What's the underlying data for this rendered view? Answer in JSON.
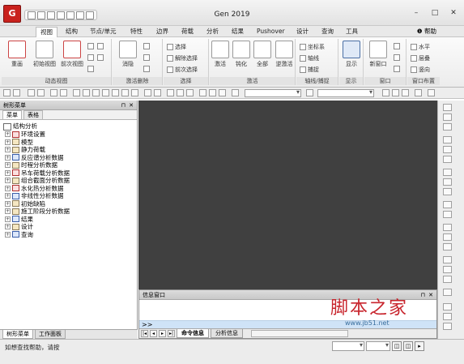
{
  "app": {
    "logo_text": "G",
    "title": "Gen 2019",
    "window_controls": [
      "–",
      "□",
      "✕"
    ]
  },
  "menu": {
    "tabs": [
      "视图",
      "结构",
      "节点/单元",
      "特性",
      "边界",
      "荷载",
      "分析",
      "结果",
      "Pushover",
      "设计",
      "查询",
      "工具"
    ],
    "active": "视图",
    "help": "帮助"
  },
  "ribbon": {
    "groups": [
      {
        "label": "动态视图",
        "big": [
          "重画",
          "初始视图",
          "前次视图"
        ]
      },
      {
        "label": "激活删除",
        "big": [
          "消隐"
        ]
      },
      {
        "label": "选择",
        "small": [
          "选择",
          "解除选择",
          "前次选择"
        ]
      },
      {
        "label": "激活",
        "big": [
          "激活",
          "钝化",
          "全部",
          "逆激活"
        ]
      },
      {
        "label": "轴线/捕捉",
        "small": [
          "坐标系",
          "轴线",
          "捕捉"
        ]
      },
      {
        "label": "显示",
        "big": [
          "显示"
        ]
      },
      {
        "label": "窗口",
        "big": [
          "新窗口"
        ]
      },
      {
        "label": "窗口布置",
        "small": [
          "水平",
          "层叠",
          "竖向"
        ]
      }
    ]
  },
  "left_panel": {
    "title": "树形菜单",
    "tabs": [
      "菜单",
      "表格"
    ],
    "active_tab": "菜单",
    "root": "结构分析",
    "items": [
      {
        "label": "环境设置",
        "tone": "red"
      },
      {
        "label": "模型",
        "tone": "normal"
      },
      {
        "label": "静力荷载",
        "tone": "normal"
      },
      {
        "label": "反应谱分析数据",
        "tone": "blue"
      },
      {
        "label": "时程分析数据",
        "tone": "normal"
      },
      {
        "label": "吊车荷载分析数据",
        "tone": "red"
      },
      {
        "label": "组合截面分析数据",
        "tone": "normal"
      },
      {
        "label": "水化热分析数据",
        "tone": "red"
      },
      {
        "label": "非线性分析数据",
        "tone": "blue"
      },
      {
        "label": "初始缺陷",
        "tone": "normal"
      },
      {
        "label": "施工阶段分析数据",
        "tone": "normal"
      },
      {
        "label": "结果",
        "tone": "blue"
      },
      {
        "label": "设计",
        "tone": "normal"
      },
      {
        "label": "查询",
        "tone": "blue"
      }
    ],
    "bottom_tabs": [
      "树形菜单",
      "工作面板"
    ],
    "active_bottom": "树形菜单"
  },
  "info_window": {
    "title": "信息窗口",
    "prompt": ">>",
    "tabs": [
      "命令信息",
      "分析信息"
    ],
    "active_tab": "命令信息"
  },
  "status": {
    "text": "如想查找帮助，请按"
  },
  "watermark": {
    "main": "脚本之家",
    "url": "www.jb51.net"
  },
  "colors": {
    "canvas": "#404040",
    "prompt_bg": "#cfe3f7",
    "logo": "#c9221d"
  }
}
